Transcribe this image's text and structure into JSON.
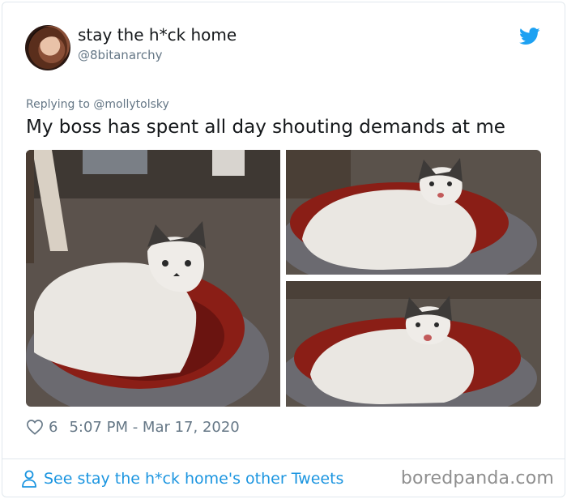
{
  "author": {
    "display_name": "stay the h*ck home",
    "handle": "@8bitanarchy"
  },
  "reply_context": "Replying to @mollytolsky",
  "tweet_text": "My boss has spent all day shouting demands at me",
  "meta": {
    "likes": "6",
    "timestamp": "5:07 PM - Mar 17, 2020"
  },
  "footer": {
    "other_tweets_label": "See stay the h*ck home's other Tweets"
  },
  "watermark": "boredpanda.com",
  "colors": {
    "link_blue": "#1b95e0",
    "muted_gray": "#657786",
    "twitter_blue": "#1da1f2"
  },
  "icons": [
    "avatar",
    "twitter-bird-icon",
    "heart-icon",
    "person-icon"
  ]
}
